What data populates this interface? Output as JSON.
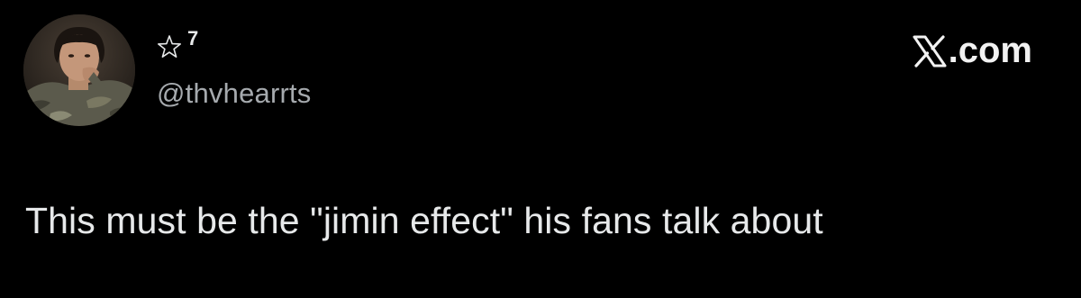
{
  "post": {
    "display_name": "7",
    "name_icon": "star-outline-icon",
    "handle": "@thvhearrts",
    "text": "This must be the \"jimin effect\" his fans talk about",
    "avatar_icon": "profile-photo"
  },
  "brand": {
    "logo_icon": "x-logo-icon",
    "label": ".com"
  },
  "colors": {
    "background": "#000000",
    "primary_text": "#e7e9ea",
    "secondary_text": "#a6aaae"
  }
}
